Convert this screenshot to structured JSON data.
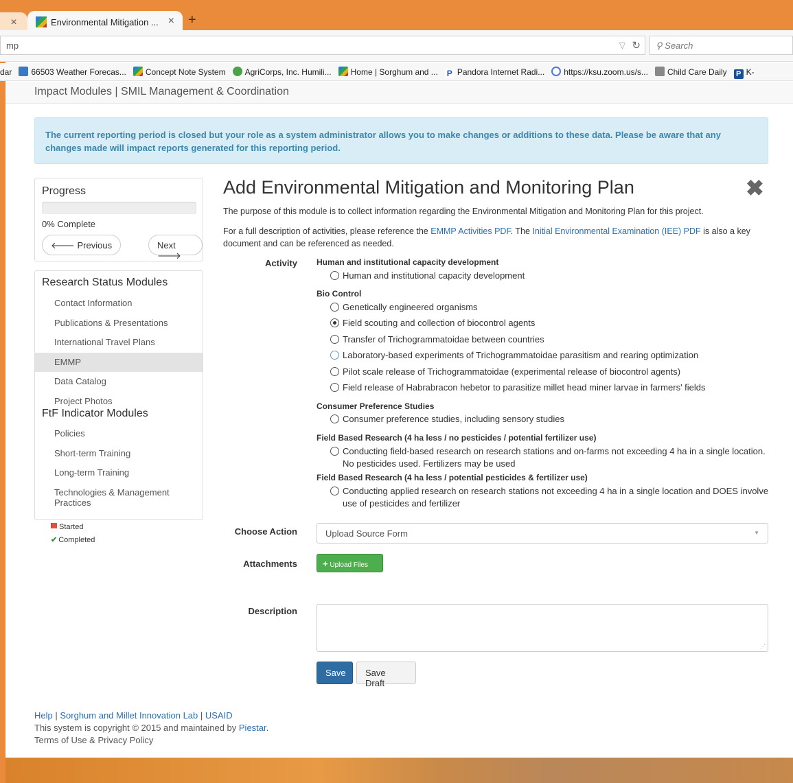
{
  "browser": {
    "tab_title": "Environmental Mitigation ...",
    "tab_close": "×",
    "new_tab": "+",
    "url_fragment": "mp",
    "search_placeholder": "Search",
    "bookmarks": [
      {
        "label": "dar",
        "icon": "none"
      },
      {
        "label": "66503 Weather Forecas...",
        "icon": "weather-icon"
      },
      {
        "label": "Concept Note System",
        "icon": "smil-icon"
      },
      {
        "label": "AgriCorps, Inc. Humili...",
        "icon": "globe-icon"
      },
      {
        "label": "Home | Sorghum and ...",
        "icon": "smil-icon"
      },
      {
        "label": "Pandora Internet Radi...",
        "icon": "pandora-icon"
      },
      {
        "label": "https://ksu.zoom.us/s...",
        "icon": "zoom-icon"
      },
      {
        "label": "Child Care Daily",
        "icon": "childcare-icon"
      },
      {
        "label": "K-",
        "icon": "k-icon"
      }
    ]
  },
  "header": {
    "title": "Impact Modules | SMIL Management & Coordination"
  },
  "alert": {
    "text": "The current reporting period is closed but your role as a system administrator allows you to make changes or additions to these data. Please be aware that any changes made will impact reports generated for this reporting period."
  },
  "progress": {
    "title": "Progress",
    "percent": 0,
    "label": "0% Complete",
    "prev_label": "Previous",
    "next_label": "Next"
  },
  "modules": {
    "research_heading": "Research Status Modules",
    "research_items": [
      "Contact Information",
      "Publications & Presentations",
      "International Travel Plans",
      "EMMP",
      "Data Catalog",
      "Project Photos"
    ],
    "active_item": "EMMP",
    "ftf_heading": "FtF Indicator Modules",
    "ftf_items": [
      "Policies",
      "Short-term Training",
      "Long-term Training",
      "Technologies & Management Practices"
    ]
  },
  "legend": {
    "started": "Started",
    "completed": "Completed"
  },
  "main": {
    "title": "Add Environmental Mitigation and Monitoring Plan",
    "purpose": "The purpose of this module is to collect information regarding the Environmental Mitigation and Monitoring Plan for this project.",
    "ref_prefix": "For a full description of activities, please reference the ",
    "ref_link1": "EMMP Activities PDF",
    "ref_middle": ". The ",
    "ref_link2": "Initial Environmental Examination (IEE) PDF",
    "ref_suffix": " is also a key document and can be referenced as needed."
  },
  "activity": {
    "label": "Activity",
    "groups": [
      {
        "heading": "Human and institutional capacity development",
        "options": [
          "Human and institutional capacity development"
        ]
      },
      {
        "heading": "Bio Control",
        "options": [
          "Genetically engineered organisms",
          "Field scouting and collection of biocontrol agents",
          "Transfer of Trichogrammatoidae between countries",
          "Laboratory-based experiments of Trichogrammatoidae parasitism and rearing optimization",
          "Pilot scale release of Trichogrammatoidae (experimental release of biocontrol agents)",
          "Field release of Habrabracon hebetor to parasitize millet head miner larvae in farmers' fields"
        ]
      },
      {
        "heading": "Consumer Preference Studies",
        "options": [
          "Consumer preference studies, including sensory studies"
        ]
      },
      {
        "heading": "Field Based Research (4 ha less / no pesticides / potential fertilizer use)",
        "options": [
          "Conducting field-based research on research stations and on-farms not exceeding 4 ha in a single location. No pesticides used. Fertilizers may be used"
        ]
      },
      {
        "heading": "Field Based Research (4 ha less / potential pesticides & fertilizer use)",
        "options": [
          "Conducting applied research on research stations not exceeding 4 ha in a single location and DOES involve use of pesticides and fertilizer"
        ]
      }
    ],
    "selected": "Field scouting and collection of biocontrol agents"
  },
  "form": {
    "choose_action_label": "Choose Action",
    "choose_action_value": "Upload Source Form",
    "attachments_label": "Attachments",
    "upload_label": "Upload Files",
    "description_label": "Description",
    "description_value": "",
    "save_label": "Save",
    "save_draft_label": "Save Draft"
  },
  "footer": {
    "help": "Help",
    "sep": " | ",
    "smil": "Sorghum and Millet Innovation Lab",
    "usaid": "USAID",
    "copyright_prefix": "This system is copyright © 2015 and maintained by ",
    "piestar": "Piestar",
    "copyright_suffix": ".",
    "terms": "Terms of Use & Privacy Policy"
  }
}
